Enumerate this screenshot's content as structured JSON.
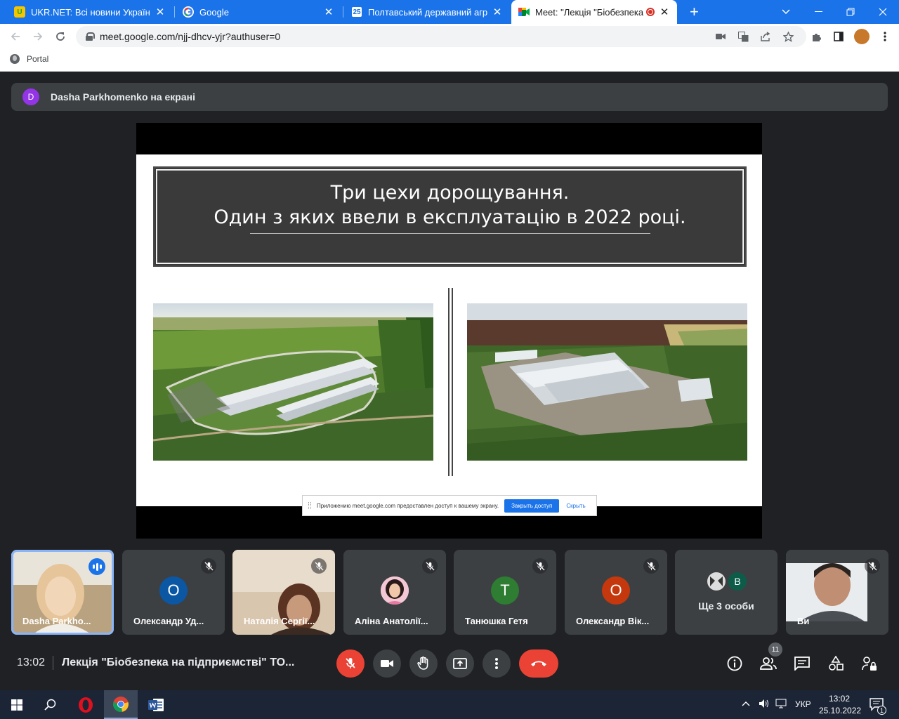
{
  "browser": {
    "tabs": [
      {
        "title": "UKR.NET: Всі новини України, ос",
        "close": "✕"
      },
      {
        "title": "Google",
        "close": "✕"
      },
      {
        "title": "Полтавський державний аграрн",
        "close": "✕"
      },
      {
        "title": "Meet: \"Лекція \"Біобезпека н",
        "close": "✕"
      }
    ],
    "new_tab": "+",
    "url": "meet.google.com/njj-dhcv-yjr?authuser=0",
    "bookmark": "Portal",
    "profile_color": "#c8782a"
  },
  "meet": {
    "presenter_initial": "D",
    "presenter_banner": "Dasha Parkhomenko на екрані",
    "slide": {
      "line1": "Три цехи дорощування.",
      "line2": "Один з яких ввели в експлуатацію в 2022 році."
    },
    "share_notice": {
      "text": "Приложению meet.google.com предоставлен доступ к вашему экрану.",
      "stop": "Закрыть доступ",
      "hide": "Скрыть"
    },
    "participants": [
      {
        "name": "Dasha Parkho...",
        "state": "speaking"
      },
      {
        "name": "Олександр Уд...",
        "initial": "О",
        "color": "#0b57a4",
        "state": "muted"
      },
      {
        "name": "Наталія Сергії...",
        "state": "muted"
      },
      {
        "name": "Аліна Анатолії...",
        "state": "muted"
      },
      {
        "name": "Танюшка Гетя",
        "initial": "Т",
        "color": "#2e7d32",
        "state": "muted"
      },
      {
        "name": "Олександр Вік...",
        "initial": "О",
        "color": "#c5380d",
        "state": "muted"
      },
      {
        "name": "Ще 3 особи",
        "extra_initial": "В",
        "extra_color": "#0d5c4a"
      },
      {
        "name": "Ви",
        "state": "muted"
      }
    ],
    "time": "13:02",
    "meeting_title": "Лекція \"Біобезпека на підприємстві\" ТО...",
    "people_count": "11",
    "colors": {
      "leave": "#ea4335",
      "accent": "#1a73e8",
      "bg": "#202124"
    }
  },
  "taskbar": {
    "lang": "УКР",
    "time": "13:02",
    "date": "25.10.2022",
    "notifications": "1"
  }
}
